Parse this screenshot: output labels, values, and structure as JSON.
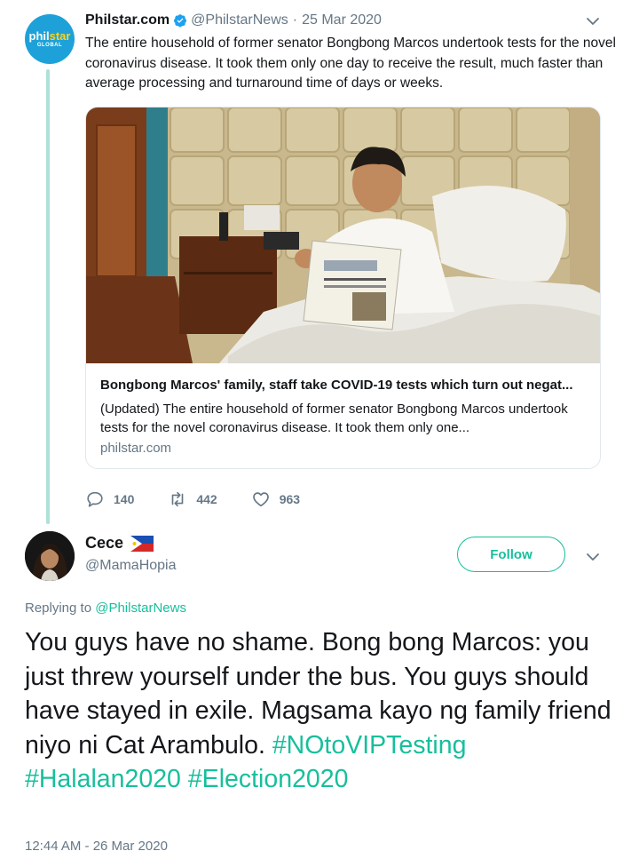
{
  "original_tweet": {
    "avatar": {
      "logo_text_main": "phil",
      "logo_text_accent": "star",
      "logo_sub": "GLOBAL"
    },
    "display_name": "Philstar.com",
    "handle": "@PhilstarNews",
    "separator": "·",
    "date": "25 Mar 2020",
    "text": "The entire household of former senator Bongbong Marcos undertook tests for the novel coronavirus disease. It took them only one day to receive the result, much faster than average processing and turnaround time of days or weeks.",
    "card": {
      "image_icon": "photo-bongbong-marcos-in-bed-with-newspaper",
      "title": "Bongbong Marcos' family, staff take COVID-19 tests which turn out negat...",
      "description": "(Updated) The entire household of former senator Bongbong Marcos undertook tests for the novel coronavirus disease. It took them only one...",
      "domain": "philstar.com"
    },
    "stats": {
      "replies": "140",
      "retweets": "442",
      "likes": "963"
    }
  },
  "reply": {
    "display_name": "Cece",
    "flag_icon": "philippines-flag-icon",
    "handle": "@MamaHopia",
    "follow_label": "Follow",
    "replying_prefix": "Replying to",
    "replying_mention": "@PhilstarNews",
    "text_parts": [
      {
        "text": "You guys have no shame. Bong bong Marcos: you just threw yourself under the bus. You guys should have stayed in exile. Magsama kayo ng family friend niyo ni Cat Arambulo.",
        "hashtag": false
      },
      {
        "text": "#NOtoVIPTesting",
        "hashtag": true
      },
      {
        "text": "#Halalan2020",
        "hashtag": true
      },
      {
        "text": "#Election2020",
        "hashtag": true
      }
    ],
    "timestamp": "12:44 AM - 26 Mar 2020"
  },
  "colors": {
    "accent": "#17bf9c",
    "secondary_text": "#657786",
    "thread_line": "#aee1d9",
    "verified": "#1da1f2"
  }
}
